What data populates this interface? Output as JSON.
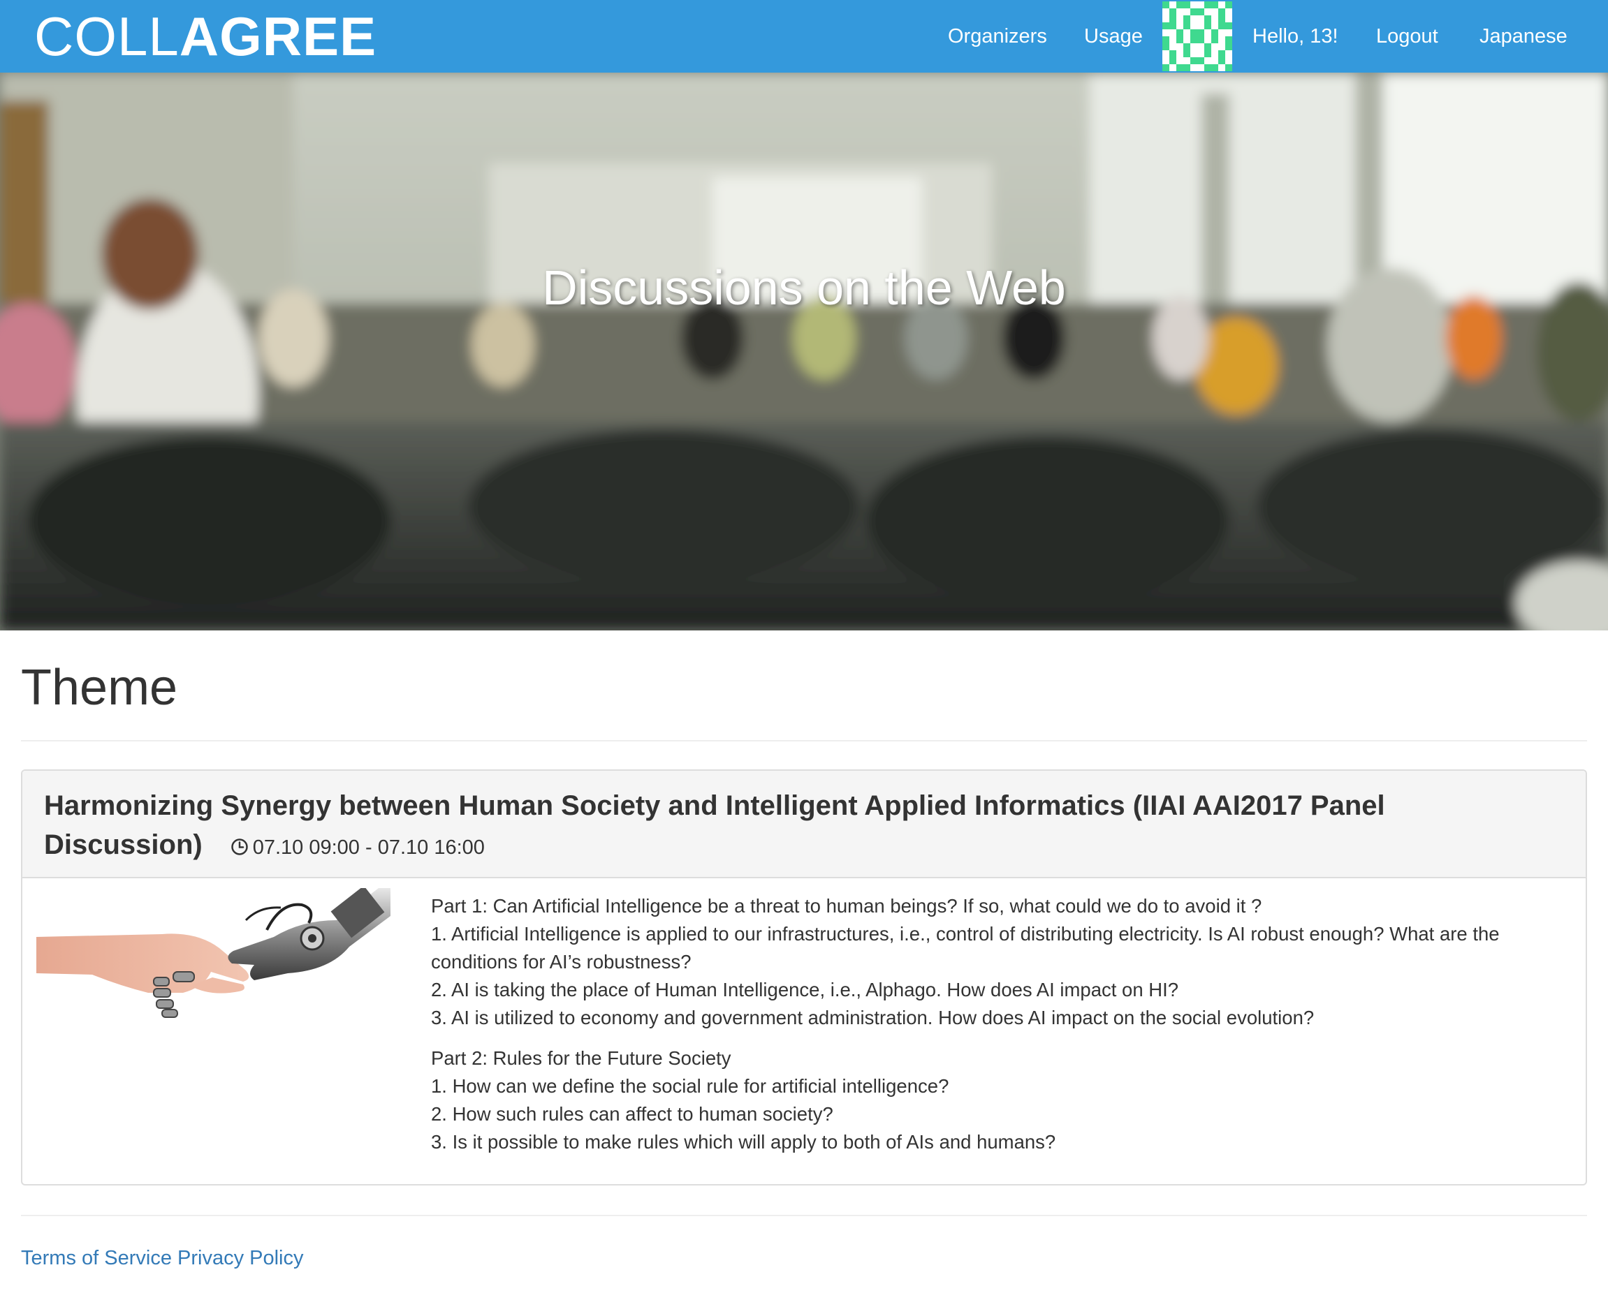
{
  "brand": {
    "light": "COLL",
    "bold": "AGREE",
    "color": "#3499dc"
  },
  "nav": {
    "organizers": "Organizers",
    "usage": "Usage",
    "greeting": "Hello, 13!",
    "logout": "Logout",
    "language": "Japanese"
  },
  "hero": {
    "title": "Discussions on the Web"
  },
  "page": {
    "heading": "Theme"
  },
  "theme": {
    "title": "Harmonizing Synergy between Human Society and Intelligent Applied Informatics (IIAI AAI2017 Panel Discussion)",
    "time_icon": "clock-icon",
    "time": "07.10 09:00 - 07.10 16:00",
    "part1": {
      "heading": "Part 1: Can Artificial Intelligence be a threat to human beings? If so, what could we do to avoid it ?",
      "items": [
        "1. Artificial Intelligence is applied to our infrastructures, i.e., control of distributing electricity. Is AI robust enough? What are the conditions for AI’s robustness?",
        "2. AI is taking the place of Human Intelligence, i.e., Alphago. How does AI impact on HI?",
        "3. AI is utilized to economy and government administration. How does AI impact on the social evolution?"
      ]
    },
    "part2": {
      "heading": "Part 2: Rules for the Future Society",
      "items": [
        "1. How can we define the social rule for artificial intelligence?",
        "2. How such rules can affect to human society?",
        "3. Is it possible to make rules which will apply to both of AIs and humans?"
      ]
    }
  },
  "footer": {
    "terms": "Terms of Service",
    "privacy": "Privacy Policy",
    "link_color": "#337ab7"
  }
}
